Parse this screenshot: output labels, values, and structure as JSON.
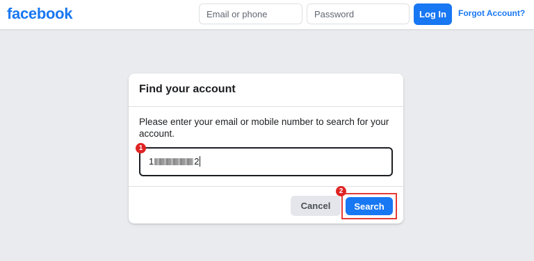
{
  "header": {
    "logo_text": "facebook",
    "email_placeholder": "Email or phone",
    "password_placeholder": "Password",
    "login_label": "Log In",
    "forgot_label": "Forgot Account?"
  },
  "find_account": {
    "title": "Find your account",
    "instructions": "Please enter your email or mobile number to search for your account.",
    "field_value_start": "1",
    "field_value_end": "2",
    "cancel_label": "Cancel",
    "search_label": "Search"
  },
  "annotations": {
    "step_1": "1",
    "step_2": "2"
  },
  "colors": {
    "brand": "#1877f2",
    "background": "#e9ebee",
    "highlight": "#e53935",
    "badge": "#e02424"
  },
  "icons": {
    "redaction": "blurred-text"
  }
}
